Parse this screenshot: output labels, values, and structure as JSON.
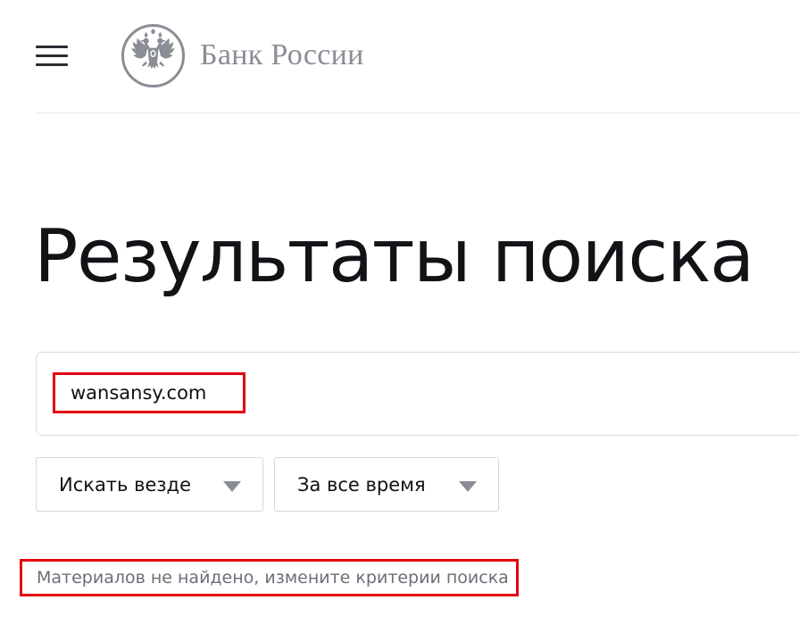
{
  "header": {
    "logo_text": "Банк России",
    "emblem_icon": "double-headed-eagle-icon",
    "menu_icon": "hamburger-menu-icon"
  },
  "page": {
    "title": "Результаты поиска"
  },
  "search": {
    "value": "wansansy.com"
  },
  "filters": {
    "scope_label": "Искать везде",
    "period_label": "За все время",
    "arrow_icon": "triangle-down-icon"
  },
  "results": {
    "message": "Материалов не найдено, измените критерии поиска"
  },
  "colors": {
    "highlight": "#e3000f",
    "logo_gray": "#8a8d95",
    "border": "#d5d7dc",
    "text": "#111111",
    "muted_text": "#6b6f77"
  }
}
